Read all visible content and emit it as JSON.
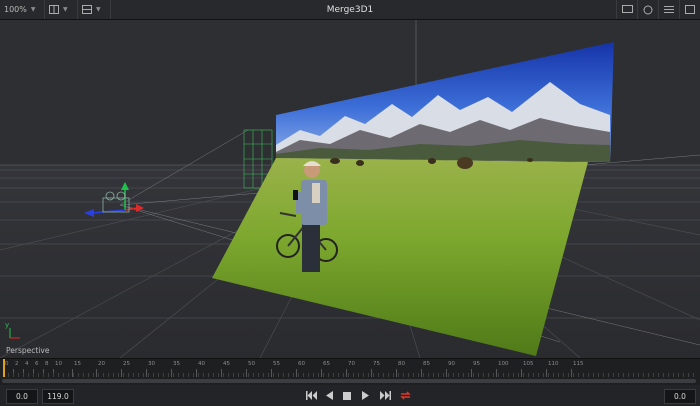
{
  "toolbar": {
    "zoom": "100%",
    "title": "Merge3D1"
  },
  "viewport": {
    "view_label": "Perspective",
    "axis_gizmo": "y"
  },
  "timeline": {
    "ticks": [
      "0",
      "2",
      "4",
      "6",
      "8",
      "10",
      "15",
      "20",
      "25",
      "30",
      "35",
      "40",
      "45",
      "50",
      "55",
      "60",
      "65",
      "70",
      "75",
      "80",
      "85",
      "90",
      "95",
      "100",
      "105",
      "110",
      "115"
    ],
    "playhead_frame": 0
  },
  "transport": {
    "start_value": "0.0",
    "end_value": "119.0",
    "current_value": "0.0"
  },
  "colors": {
    "loop_active": "#e0392b",
    "playhead": "#e0a020"
  }
}
